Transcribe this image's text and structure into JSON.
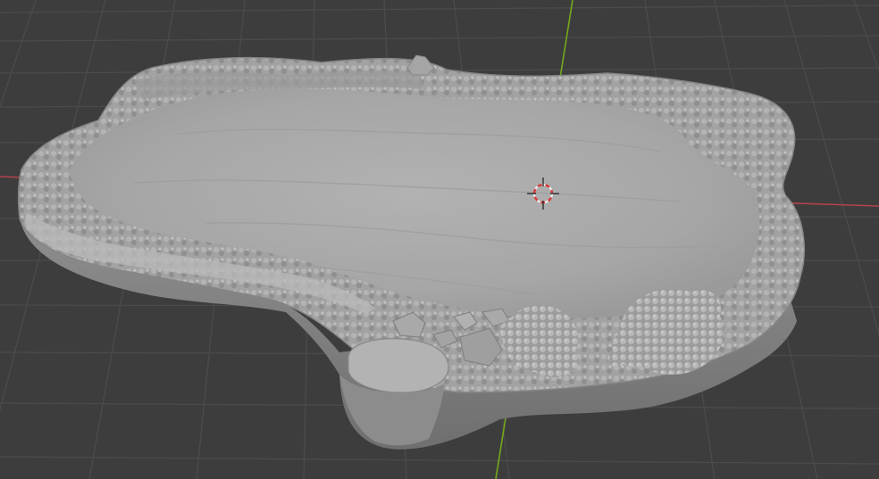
{
  "viewport": {
    "name": "3D Viewport",
    "background_color": "#3d3d3d",
    "grid_color": "#4c4c4c",
    "x_axis_color": "#c9455a",
    "y_axis_color": "#7fb51f"
  },
  "scene": {
    "object": "sculpted-pond-terrain-base",
    "shading": "solid",
    "mesh_color": "#a8a8a8"
  },
  "cursor": {
    "icon": "3d-cursor-icon",
    "colors": [
      "#e0e0e0",
      "#d63c3c"
    ]
  }
}
